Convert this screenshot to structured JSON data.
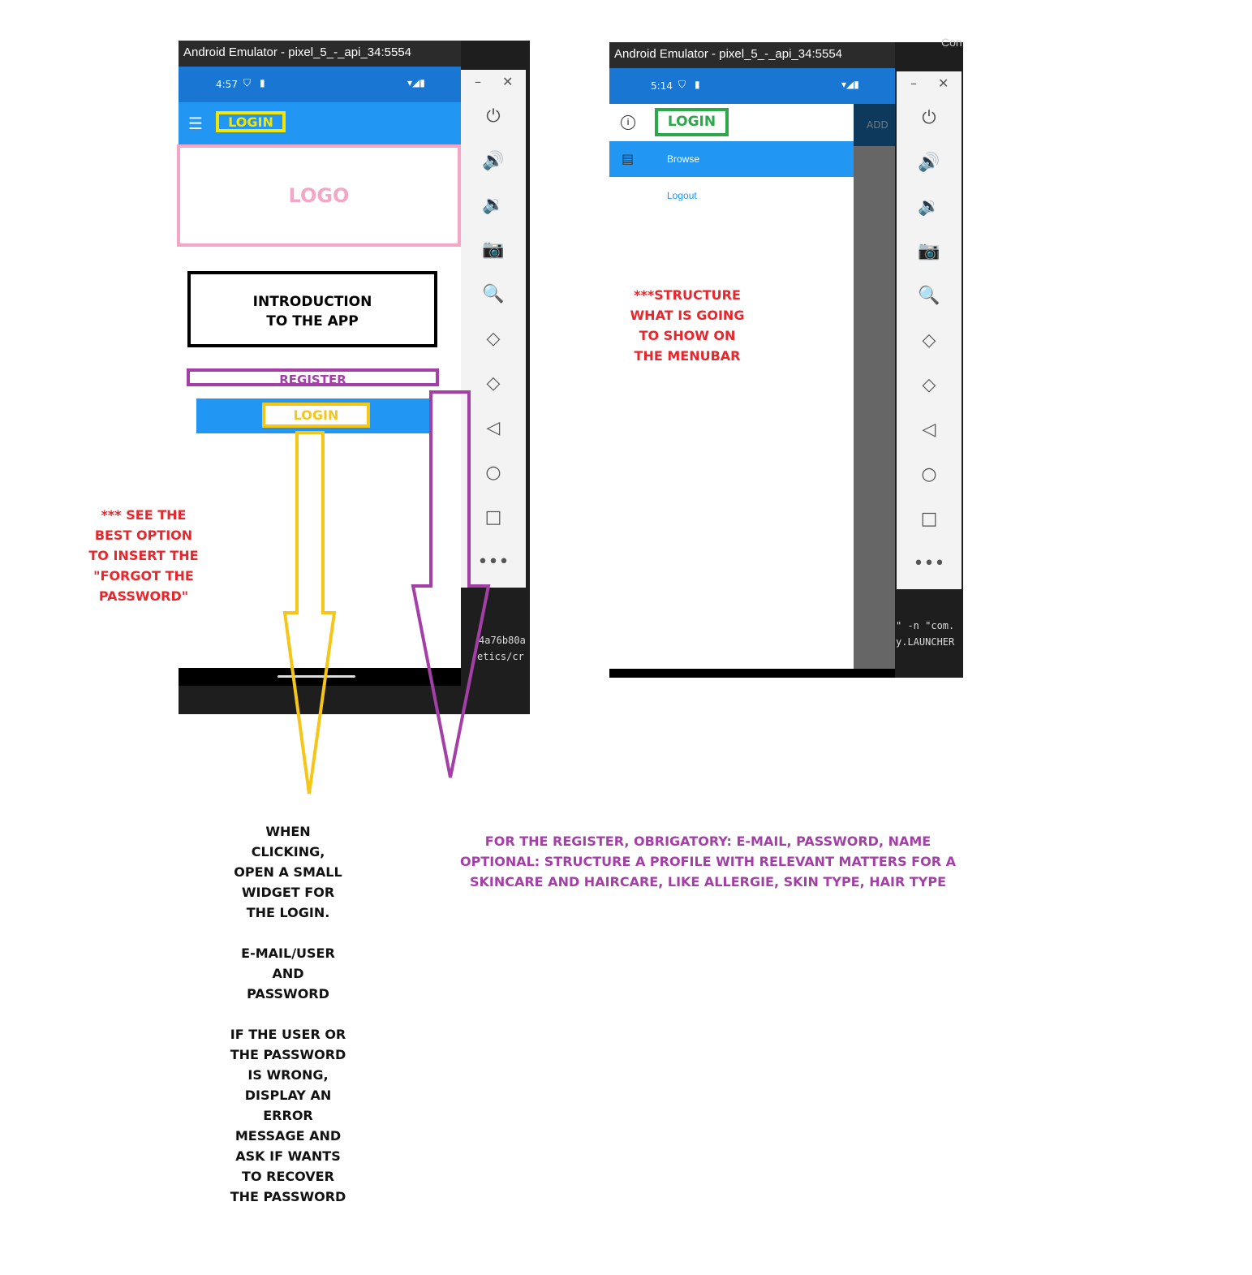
{
  "left": {
    "window_title": "Android Emulator - pixel_5_-_api_34:5554",
    "time": "4:57",
    "appbar_title": "LOGIN",
    "logo_text": "LOGO",
    "intro_text_1": "INTRODUCTION",
    "intro_text_2": "TO THE APP",
    "register_label": "REGISTER",
    "login_button_label": "LOGIN",
    "terminal_line_1": "4a76b80a",
    "terminal_line_2": "etics/cr"
  },
  "right": {
    "window_title": "Android Emulator - pixel_5_-_api_34:5554",
    "time": "5:14",
    "flyout_title": "LOGIN",
    "add_label": "ADD",
    "menu_items": [
      {
        "label": "Browse"
      },
      {
        "label": "Logout"
      }
    ],
    "terminal_line_1": "\" -n \"com.",
    "terminal_line_2": "y.LAUNCHER",
    "corner_text": "Con"
  },
  "annotations": {
    "forgot_password": [
      "*** SEE THE",
      "BEST OPTION",
      "TO INSERT THE",
      "\"FORGOT THE",
      "PASSWORD\""
    ],
    "menubar": [
      "***STRUCTURE",
      "WHAT IS GOING",
      "TO SHOW ON",
      "THE MENUBAR"
    ],
    "login_widget": [
      "WHEN",
      "CLICKING,",
      "OPEN A SMALL",
      "WIDGET FOR",
      "THE LOGIN.",
      "",
      "E-MAIL/USER",
      "AND",
      "PASSWORD",
      "",
      "IF THE USER OR",
      "THE PASSWORD",
      "IS WRONG,",
      "DISPLAY AN",
      "ERROR",
      "MESSAGE AND",
      "ASK IF WANTS",
      "TO RECOVER",
      "THE PASSWORD"
    ],
    "register": [
      "FOR THE REGISTER, OBRIGATORY: E-MAIL, PASSWORD, NAME",
      "OPTIONAL: STRUCTURE A PROFILE WITH RELEVANT MATTERS FOR A",
      "SKINCARE AND HAIRCARE, LIKE ALLERGIE, SKIN TYPE, HAIR TYPE"
    ]
  },
  "colors": {
    "statusbar": "#1976d2",
    "appbar": "#2196f3",
    "logo_border": "#f4a6c6",
    "yellow": "#f5c518",
    "purple": "#a53fa8",
    "green": "#2aa84a",
    "red": "#e8262b"
  },
  "side_icons": [
    "power-icon",
    "volume-up-icon",
    "volume-down-icon",
    "camera-icon",
    "zoom-icon",
    "rotate-left-icon",
    "rotate-right-icon",
    "back-icon",
    "home-icon",
    "overview-icon",
    "more-icon"
  ]
}
